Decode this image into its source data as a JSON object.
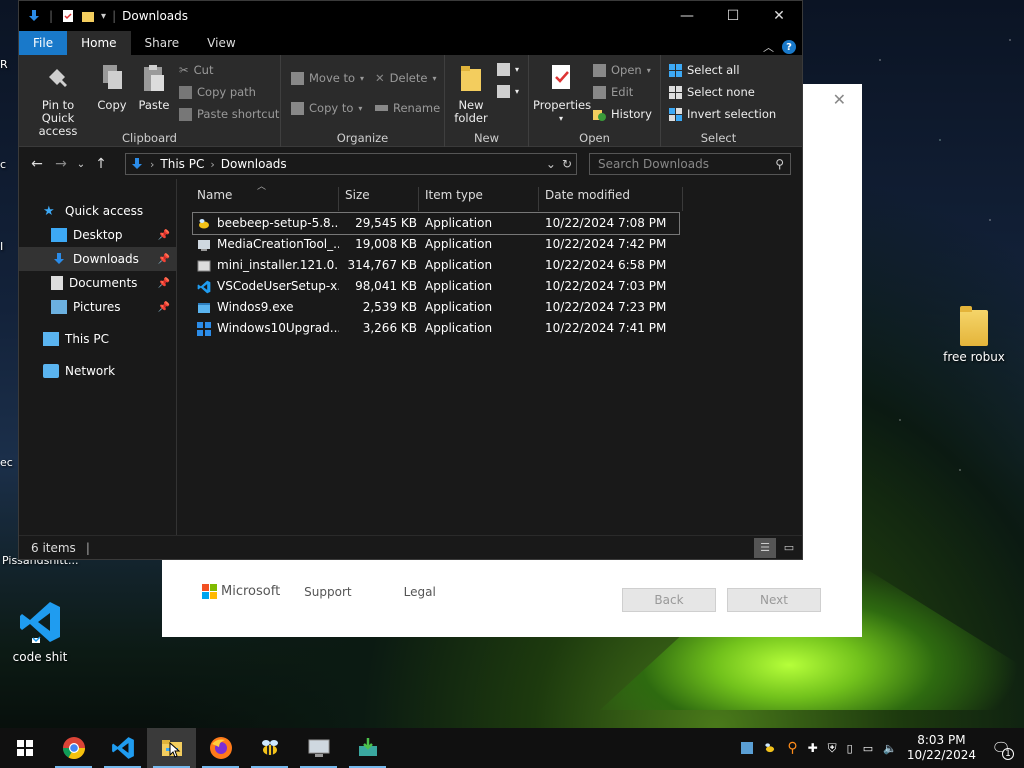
{
  "desktop": {
    "folder_label": "free robux",
    "vscode_label": "code shit",
    "clipped_labels": [
      "R",
      "c",
      "I",
      "ec",
      "Pissandshitt..."
    ]
  },
  "installer": {
    "brand": "Microsoft",
    "support": "Support",
    "legal": "Legal",
    "back": "Back",
    "next": "Next"
  },
  "explorer": {
    "title": "Downloads",
    "tabs": [
      "File",
      "Home",
      "Share",
      "View"
    ],
    "ribbon": {
      "clipboard": {
        "label": "Clipboard",
        "pin": "Pin to Quick access",
        "copy": "Copy",
        "paste": "Paste",
        "cut": "Cut",
        "copy_path": "Copy path",
        "paste_shortcut": "Paste shortcut"
      },
      "organize": {
        "label": "Organize",
        "move_to": "Move to",
        "copy_to": "Copy to",
        "delete": "Delete",
        "rename": "Rename"
      },
      "new": {
        "label": "New",
        "new_folder_1": "New",
        "new_folder_2": "folder"
      },
      "open": {
        "label": "Open",
        "properties": "Properties",
        "open": "Open",
        "edit": "Edit",
        "history": "History"
      },
      "select": {
        "label": "Select",
        "select_all": "Select all",
        "select_none": "Select none",
        "invert": "Invert selection"
      }
    },
    "address": {
      "this_pc": "This PC",
      "downloads": "Downloads"
    },
    "search_placeholder": "Search Downloads",
    "nav": {
      "quick_access": "Quick access",
      "desktop": "Desktop",
      "downloads": "Downloads",
      "documents": "Documents",
      "pictures": "Pictures",
      "this_pc": "This PC",
      "network": "Network"
    },
    "columns": {
      "name": "Name",
      "size": "Size",
      "type": "Item type",
      "date": "Date modified"
    },
    "files": [
      {
        "name": "beebeep-setup-5.8....",
        "size": "29,545 KB",
        "type": "Application",
        "date": "10/22/2024 7:08 PM"
      },
      {
        "name": "MediaCreationTool_...",
        "size": "19,008 KB",
        "type": "Application",
        "date": "10/22/2024 7:42 PM"
      },
      {
        "name": "mini_installer.121.0....",
        "size": "314,767 KB",
        "type": "Application",
        "date": "10/22/2024 6:58 PM"
      },
      {
        "name": "VSCodeUserSetup-x...",
        "size": "98,041 KB",
        "type": "Application",
        "date": "10/22/2024 7:03 PM"
      },
      {
        "name": "Windos9.exe",
        "size": "2,539 KB",
        "type": "Application",
        "date": "10/22/2024 7:23 PM"
      },
      {
        "name": "Windows10Upgrad...",
        "size": "3,266 KB",
        "type": "Application",
        "date": "10/22/2024 7:41 PM"
      }
    ],
    "status": "6 items"
  },
  "taskbar": {
    "time": "8:03 PM",
    "date": "10/22/2024",
    "notification_count": "1"
  }
}
